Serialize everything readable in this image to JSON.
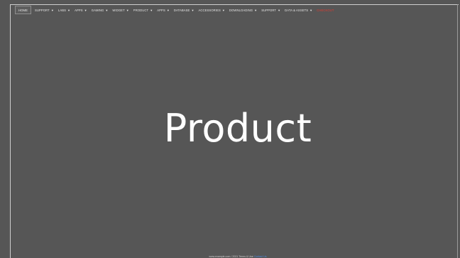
{
  "nav": {
    "items": [
      {
        "label": "Home",
        "dropdown": false,
        "active": true
      },
      {
        "label": "Support",
        "dropdown": true
      },
      {
        "label": "Labs",
        "dropdown": true
      },
      {
        "label": "Apps",
        "dropdown": true
      },
      {
        "label": "Gaming",
        "dropdown": true
      },
      {
        "label": "Widget",
        "dropdown": true
      },
      {
        "label": "Product",
        "dropdown": true
      },
      {
        "label": "Apps",
        "dropdown": true
      },
      {
        "label": "Database",
        "dropdown": true
      },
      {
        "label": "Accessories",
        "dropdown": true
      },
      {
        "label": "Downloading",
        "dropdown": true
      },
      {
        "label": "Support",
        "dropdown": true
      },
      {
        "label": "Data & Assets",
        "dropdown": true
      },
      {
        "label": "Checkout",
        "dropdown": false,
        "highlight": true
      }
    ]
  },
  "hero": {
    "title": "Product"
  },
  "footer": {
    "text": "www.example.com / 2021 Terms & Use",
    "link": "Contact Us"
  },
  "colors": {
    "background": "#565656",
    "text": "#ffffff",
    "highlight": "#e23a2f",
    "link": "#4f8fe6"
  }
}
